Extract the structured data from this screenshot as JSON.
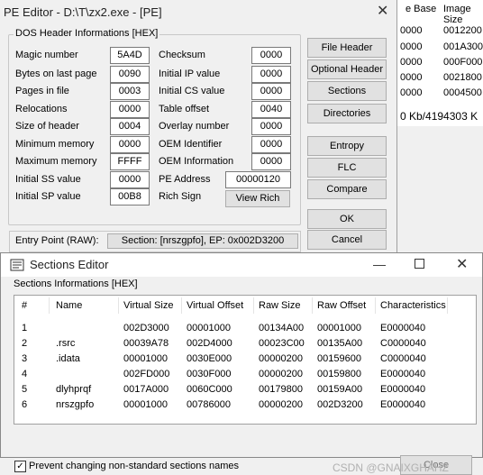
{
  "background": {
    "headers": [
      "e Base",
      "Image Size"
    ],
    "col1": [
      "0000",
      "0000",
      "0000",
      "0000",
      "0000"
    ],
    "col2": [
      "0012200",
      "001A300",
      "000F000",
      "0021800",
      "0004500"
    ],
    "status": "0 Kb/4194303 K"
  },
  "pe_editor": {
    "title": "PE Editor - D:\\T\\zx2.exe - [PE]",
    "group_title": "DOS Header Informations [HEX]",
    "left_fields": [
      {
        "label": "Magic number",
        "value": "5A4D"
      },
      {
        "label": "Bytes on last page",
        "value": "0090"
      },
      {
        "label": "Pages in file",
        "value": "0003"
      },
      {
        "label": "Relocations",
        "value": "0000"
      },
      {
        "label": "Size of header",
        "value": "0004"
      },
      {
        "label": "Minimum memory",
        "value": "0000"
      },
      {
        "label": "Maximum memory",
        "value": "FFFF"
      },
      {
        "label": "Initial SS value",
        "value": "0000"
      },
      {
        "label": "Initial SP value",
        "value": "00B8"
      }
    ],
    "right_fields": [
      {
        "label": "Checksum",
        "value": "0000"
      },
      {
        "label": "Initial IP value",
        "value": "0000"
      },
      {
        "label": "Initial CS value",
        "value": "0000"
      },
      {
        "label": "Table offset",
        "value": "0040"
      },
      {
        "label": "Overlay number",
        "value": "0000"
      },
      {
        "label": "OEM Identifier",
        "value": "0000"
      },
      {
        "label": "OEM Information",
        "value": "0000"
      }
    ],
    "pe_address_label": "PE Address",
    "pe_address_value": "00000120",
    "rich_sign_label": "Rich Sign",
    "view_rich": "View Rich",
    "buttons": [
      "File Header",
      "Optional Header",
      "Sections",
      "Directories",
      "Entropy",
      "FLC",
      "Compare",
      "OK",
      "Cancel"
    ],
    "entry_label": "Entry Point (RAW):",
    "entry_value": "Section: [nrszgpfo], EP: 0x002D3200"
  },
  "sections_editor": {
    "title": "Sections Editor",
    "group_title": "Sections Informations [HEX]",
    "columns": [
      "#",
      "Name",
      "Virtual Size",
      "Virtual Offset",
      "Raw Size",
      "Raw Offset",
      "Characteristics"
    ],
    "rows": [
      [
        "1",
        "",
        "002D3000",
        "00001000",
        "00134A00",
        "00001000",
        "E0000040"
      ],
      [
        "2",
        ".rsrc",
        "00039A78",
        "002D4000",
        "00023C00",
        "00135A00",
        "C0000040"
      ],
      [
        "3",
        ".idata",
        "00001000",
        "0030E000",
        "00000200",
        "00159600",
        "C0000040"
      ],
      [
        "4",
        "",
        "002FD000",
        "0030F000",
        "00000200",
        "00159800",
        "E0000040"
      ],
      [
        "5",
        "dlyhprqf",
        "0017A000",
        "0060C000",
        "00179800",
        "00159A00",
        "E0000040"
      ],
      [
        "6",
        "nrszgpfo",
        "00001000",
        "00786000",
        "00000200",
        "002D3200",
        "E0000040"
      ]
    ],
    "checkbox_label": "Prevent changing non-standard sections names",
    "checkbox_checked": true,
    "close_label": "Close",
    "watermark": "CSDN @GNAIXGHAHZ"
  }
}
